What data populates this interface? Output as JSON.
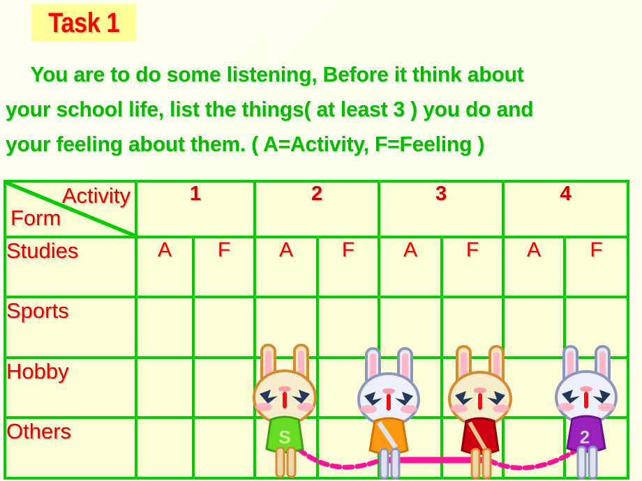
{
  "slide": {
    "background_color": "#fffff0",
    "accent_green": "#00cc00",
    "accent_red": "#e00000",
    "badge_yellow": "#ffff99"
  },
  "task_badge": {
    "label": "Task 1"
  },
  "instructions": {
    "line1": "You are to do some listening, Before it think about",
    "line2": "your school life, list the things( at least 3 ) you do and",
    "line3": "your feeling about them. ( A=Activity, F=Feeling )"
  },
  "table": {
    "corner": {
      "top_right_label": "Activity",
      "bottom_left_label": "Form"
    },
    "column_headers": [
      "1",
      "2",
      "3",
      "4"
    ],
    "sub_headers": [
      "A",
      "F",
      "A",
      "F",
      "A",
      "F",
      "A",
      "F"
    ],
    "row_headers": [
      "Studies",
      "Sports",
      "Hobby",
      "Others"
    ],
    "rows": [
      {
        "label": "Studies",
        "cells": [
          "A",
          "F",
          "A",
          "F",
          "A",
          "F",
          "A",
          "F"
        ]
      },
      {
        "label": "Sports",
        "cells": [
          "",
          "",
          "",
          "",
          "",
          "",
          "",
          ""
        ]
      },
      {
        "label": "Hobby",
        "cells": [
          "",
          "",
          "",
          "",
          "",
          "",
          "",
          ""
        ]
      },
      {
        "label": "Others",
        "cells": [
          "",
          "",
          "",
          "",
          "",
          "",
          "",
          ""
        ]
      }
    ]
  },
  "decorations": {
    "bunnies": [
      {
        "name": "bunny-1",
        "fur": "#f7e7bd",
        "outline": "#d78a32",
        "shirt": "#66dd22",
        "shirt_letter": "S"
      },
      {
        "name": "bunny-2",
        "fur": "#dfe2f2",
        "outline": "#8d96bd",
        "shirt": "#ff9911",
        "shirt_letter": ""
      },
      {
        "name": "bunny-3",
        "fur": "#f7e7bd",
        "outline": "#d78a32",
        "shirt": "#cc0011",
        "shirt_letter": ""
      },
      {
        "name": "bunny-4",
        "fur": "#dfe2f2",
        "outline": "#8d96bd",
        "shirt": "#9922bb",
        "shirt_letter": "2"
      }
    ],
    "jump_rope_color": "#ff1199"
  }
}
